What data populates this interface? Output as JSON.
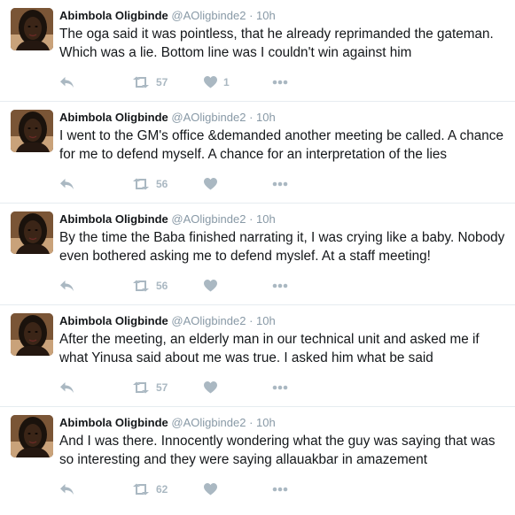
{
  "tweets": [
    {
      "name": "Abimbola Oligbinde",
      "handle": "@AOligbinde2",
      "separator": "·",
      "time": "10h",
      "text": "The oga said it was pointless, that he already reprimanded the gateman. Which was a lie. Bottom line was I couldn't win against him",
      "retweets": "57",
      "likes": "1"
    },
    {
      "name": "Abimbola Oligbinde",
      "handle": "@AOligbinde2",
      "separator": "·",
      "time": "10h",
      "text": "I went to the GM's office &demanded another meeting be called. A chance for me to defend myself. A chance for an interpretation of the lies",
      "retweets": "56",
      "likes": ""
    },
    {
      "name": "Abimbola Oligbinde",
      "handle": "@AOligbinde2",
      "separator": "·",
      "time": "10h",
      "text": "By the time the Baba finished narrating it, I was crying like a baby. Nobody even bothered asking me to defend myslef. At a staff meeting!",
      "retweets": "56",
      "likes": ""
    },
    {
      "name": "Abimbola Oligbinde",
      "handle": "@AOligbinde2",
      "separator": "·",
      "time": "10h",
      "text": "After the meeting, an elderly man in our technical unit and asked me if what Yinusa said about me was true. I asked him what be said",
      "retweets": "57",
      "likes": ""
    },
    {
      "name": "Abimbola Oligbinde",
      "handle": "@AOligbinde2",
      "separator": "·",
      "time": "10h",
      "text": "And I was there. Innocently wondering what the guy was saying that was so interesting and they were saying allauakbar in amazement",
      "retweets": "62",
      "likes": ""
    }
  ],
  "icons": {
    "reply": "reply-icon",
    "retweet": "retweet-icon",
    "like": "heart-icon",
    "more": "more-icon"
  },
  "colors": {
    "action_gray": "#aab8c2",
    "meta_gray": "#8899a6",
    "divider": "#e6ecf0",
    "text": "#14171a"
  }
}
